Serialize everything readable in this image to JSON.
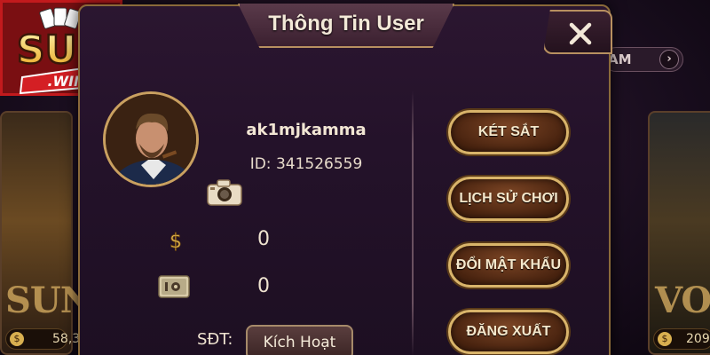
{
  "logo": {
    "main": "SUN",
    "sub": ".WIN"
  },
  "background": {
    "left_card": {
      "title": "SUN",
      "amount": "58,3"
    },
    "right_card": {
      "title": "VOI",
      "amount": "209"
    },
    "top_pill": "AM",
    "amount_icon": "dollar-coin-icon"
  },
  "dialog": {
    "title": "Thông Tin User",
    "close_icon": "close-icon",
    "profile": {
      "username": "ak1mjkamma",
      "id_text": "ID: 341526559",
      "camera_icon": "camera-icon"
    },
    "balances": [
      {
        "icon": "dollar-icon",
        "value": "0"
      },
      {
        "icon": "safe-icon",
        "value": "0"
      }
    ],
    "phone": {
      "label": "SĐT:",
      "button": "Kích Hoạt"
    },
    "actions": [
      {
        "label": "KÉT SẮT"
      },
      {
        "label": "LỊCH SỬ CHƠI"
      },
      {
        "label": "ĐỔI MẬT KHẨU"
      },
      {
        "label": "ĐĂNG XUẤT"
      }
    ]
  },
  "colors": {
    "gold": "#d9b46a",
    "panel": "#24122a",
    "logo_red": "#c21a1d"
  }
}
